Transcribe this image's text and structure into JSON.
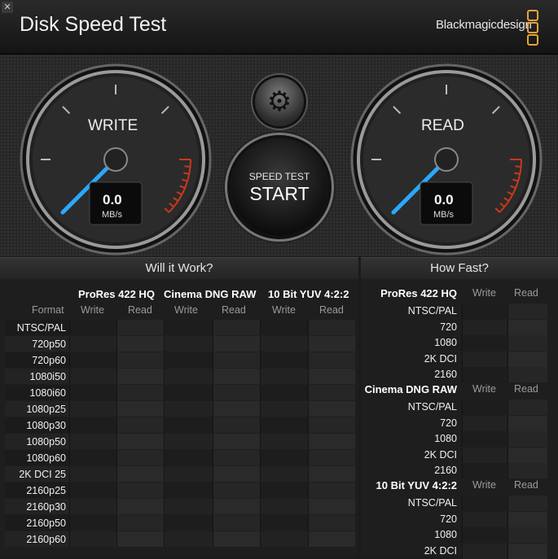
{
  "app": {
    "close_glyph": "✕",
    "title": "Disk Speed Test",
    "brand": "Blackmagicdesign"
  },
  "gauges": {
    "write": {
      "label": "WRITE",
      "value": "0.0",
      "unit": "MB/s"
    },
    "read": {
      "label": "READ",
      "value": "0.0",
      "unit": "MB/s"
    }
  },
  "controls": {
    "settings_icon": "gear-icon",
    "start_small": "SPEED TEST",
    "start_big": "START"
  },
  "will_it_work": {
    "title": "Will it Work?",
    "format_header": "Format",
    "codecs": [
      "ProRes 422 HQ",
      "Cinema DNG RAW",
      "10 Bit YUV 4:2:2"
    ],
    "col_write": "Write",
    "col_read": "Read",
    "formats": [
      "NTSC/PAL",
      "720p50",
      "720p60",
      "1080i50",
      "1080i60",
      "1080p25",
      "1080p30",
      "1080p50",
      "1080p60",
      "2K DCI 25",
      "2160p25",
      "2160p30",
      "2160p50",
      "2160p60"
    ]
  },
  "how_fast": {
    "title": "How Fast?",
    "col_write": "Write",
    "col_read": "Read",
    "groups": [
      {
        "codec": "ProRes 422 HQ",
        "rows": [
          "NTSC/PAL",
          "720",
          "1080",
          "2K DCI",
          "2160"
        ]
      },
      {
        "codec": "Cinema DNG RAW",
        "rows": [
          "NTSC/PAL",
          "720",
          "1080",
          "2K DCI",
          "2160"
        ]
      },
      {
        "codec": "10 Bit YUV 4:2:2",
        "rows": [
          "NTSC/PAL",
          "720",
          "1080",
          "2K DCI"
        ]
      }
    ]
  },
  "colors": {
    "needle": "#2aa8ff",
    "redline": "#c8381e",
    "accent": "#e8a33a"
  }
}
